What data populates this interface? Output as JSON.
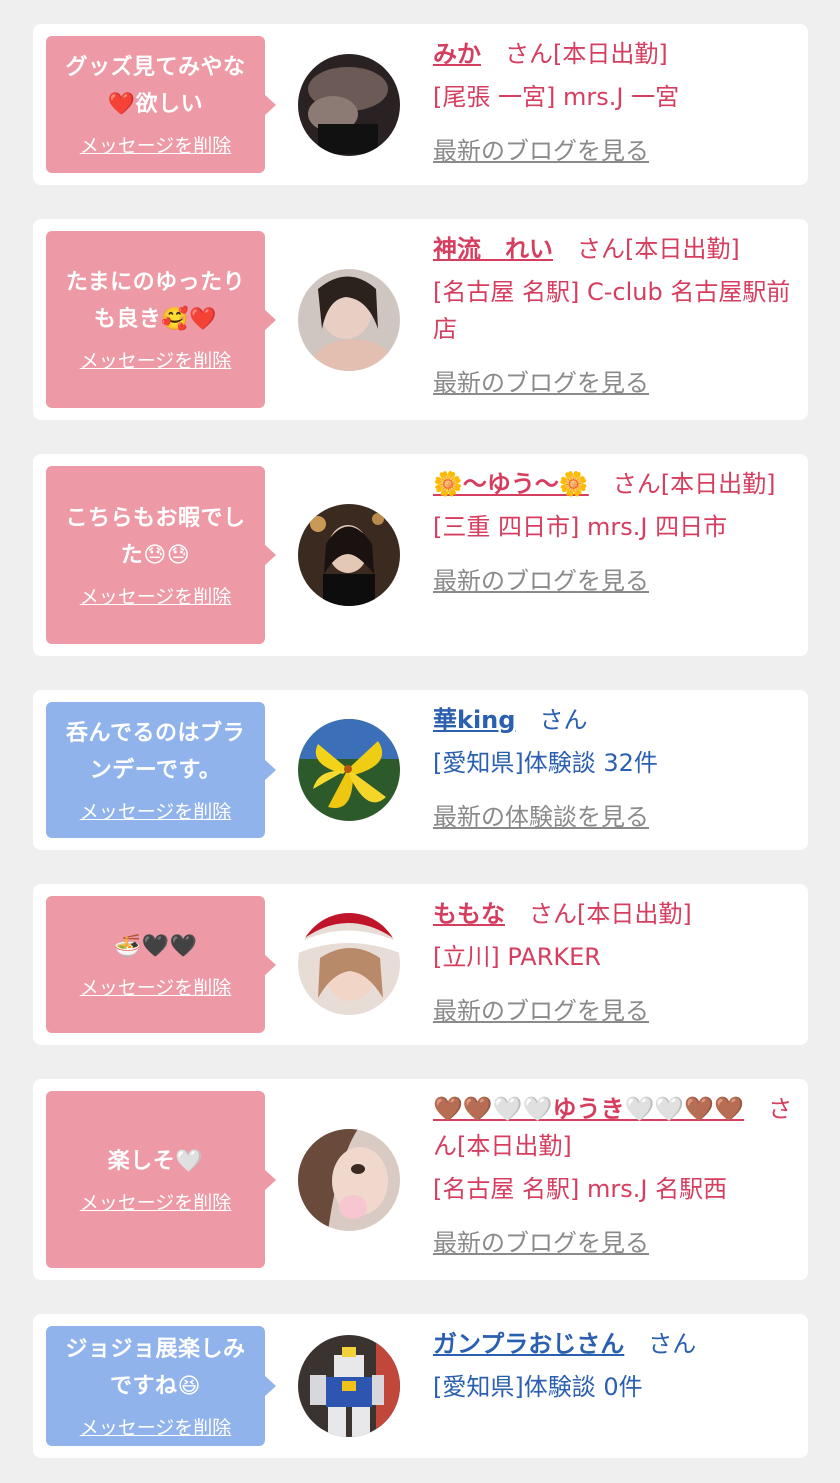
{
  "delete_label": "メッセージを削除",
  "colors": {
    "pink_bubble": "#ee9aa6",
    "blue_bubble": "#91b3ec",
    "pink_text": "#d63e5f",
    "blue_text": "#2b5fb0",
    "link_gray": "#8a8a8a",
    "background": "#efefef"
  },
  "items": [
    {
      "message": "グッズ見てみやな\n❤️欲しい",
      "name": "みか",
      "suffix": "さん[本日出勤]",
      "shop": "[尾張 一宮] mrs.J 一宮",
      "link": "最新のブログを見る",
      "kind": "pink"
    },
    {
      "message": "たまにのゆったり\nも良き🥰❤️",
      "name": "神流　れい",
      "suffix": "さん[本日出勤]",
      "shop": "[名古屋 名駅] C-club 名古屋駅前店",
      "link": "最新のブログを見る",
      "kind": "pink"
    },
    {
      "message": "こちらもお暇でし\nた😓😓",
      "name": "🌼〜ゆう〜🌼",
      "suffix": "さん[本日出勤]",
      "shop": "[三重 四日市] mrs.J 四日市",
      "link": "最新のブログを見る",
      "kind": "pink"
    },
    {
      "message": "呑んでるのはブラ\nンデーです。",
      "name": "華king",
      "suffix": "さん",
      "shop": "[愛知県]体験談 32件",
      "link": "最新の体験談を見る",
      "kind": "blue"
    },
    {
      "message": "🍜🖤🖤",
      "name": "ももな",
      "suffix": "さん[本日出勤]",
      "shop": "[立川] PARKER",
      "link": "最新のブログを見る",
      "kind": "pink"
    },
    {
      "message": "楽しそ🤍",
      "name": "🤎🤎🤍🤍ゆうき🤍🤍🤎🤎",
      "suffix": "さん[本日出勤]",
      "shop": "[名古屋 名駅] mrs.J 名駅西",
      "link": "最新のブログを見る",
      "kind": "pink"
    },
    {
      "message": "ジョジョ展楽しみ\nですね😆",
      "name": "ガンプラおじさん",
      "suffix": "さん",
      "shop": "[愛知県]体験談 0件",
      "link": "",
      "kind": "blue"
    }
  ]
}
